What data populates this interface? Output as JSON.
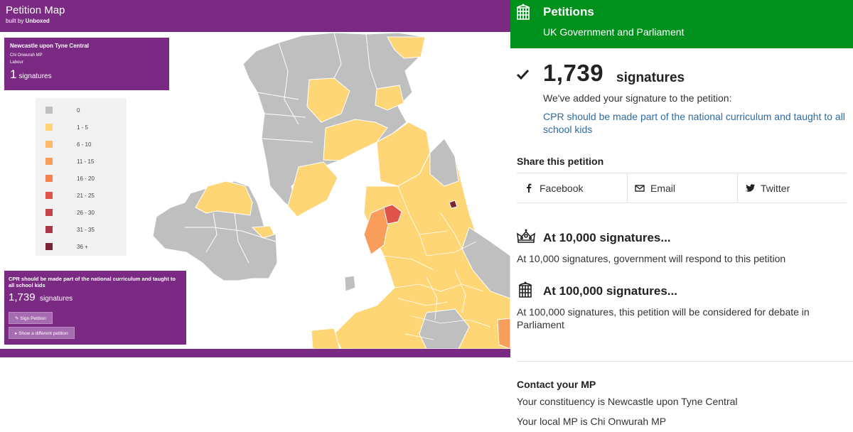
{
  "map": {
    "title": "Petition Map",
    "credit_prefix": "built by ",
    "credit_name": "Unboxed",
    "constituency_panel": {
      "name": "Newcastle upon Tyne Central",
      "mp": "Chi Onwurah MP",
      "party": "Labour",
      "count": "1",
      "count_label": "signatures"
    },
    "legend": [
      {
        "label": "0",
        "color": "#bfbfbf"
      },
      {
        "label": "1 - 5",
        "color": "#ffd675"
      },
      {
        "label": "6 - 10",
        "color": "#fdbb69"
      },
      {
        "label": "11 - 15",
        "color": "#f99d5a"
      },
      {
        "label": "16 - 20",
        "color": "#f5814f"
      },
      {
        "label": "21 - 25",
        "color": "#e0534a"
      },
      {
        "label": "26 - 30",
        "color": "#c6434b"
      },
      {
        "label": "31 - 35",
        "color": "#a83646"
      },
      {
        "label": "36 +",
        "color": "#7a2535"
      }
    ],
    "petition_panel": {
      "title": "CPR should be made part of the national curriculum and taught to all school kids",
      "count": "1,739",
      "count_label": "signatures",
      "sign_button": "✎ Sign Petition",
      "show_button": "▸ Show a different petition"
    },
    "colors": {
      "purple": "#7a2a82",
      "grey": "#bfbfbf",
      "yellow": "#ffd675"
    }
  },
  "site": {
    "name": "Petitions",
    "subtitle": "UK Government and Parliament",
    "signature_count": "1,739",
    "signature_label": "signatures",
    "added_message": "We've added your signature to the petition:",
    "petition_title": "CPR should be made part of the national curriculum and taught to all school kids",
    "share_heading": "Share this petition",
    "share": {
      "facebook": "Facebook",
      "email": "Email",
      "twitter": "Twitter"
    },
    "milestone1": {
      "heading": "At 10,000 signatures...",
      "text": "At 10,000 signatures, government will respond to this petition"
    },
    "milestone2": {
      "heading": "At 100,000 signatures...",
      "text": "At 100,000 signatures, this petition will be considered for debate in Parliament"
    },
    "contact": {
      "heading": "Contact your MP",
      "constituency_line": "Your constituency is Newcastle upon Tyne Central",
      "mp_line": "Your local MP is Chi Onwurah MP"
    },
    "colors": {
      "green": "#00901c",
      "link": "#2e6aa1"
    }
  }
}
